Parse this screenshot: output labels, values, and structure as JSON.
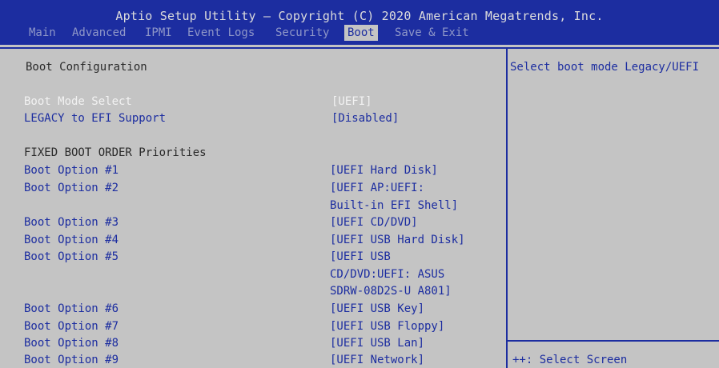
{
  "app": {
    "title": "Aptio Setup Utility – Copyright (C) 2020 American Megatrends, Inc."
  },
  "tabs": [
    "Main",
    "Advanced",
    "IPMI",
    "Event Logs",
    "Security",
    "Boot",
    "Save & Exit"
  ],
  "active_tab": "Boot",
  "left": {
    "section_title": "Boot Configuration",
    "boot_mode": {
      "label": "Boot Mode Select",
      "value": "[UEFI]"
    },
    "legacy": {
      "label": "LEGACY to EFI Support",
      "value": "[Disabled]"
    },
    "priorities_title": "FIXED BOOT ORDER Priorities",
    "boot_options": [
      {
        "label": "Boot Option #1",
        "value_lines": [
          "[UEFI Hard Disk]"
        ]
      },
      {
        "label": "Boot Option #2",
        "value_lines": [
          "[UEFI AP:UEFI:",
          "Built-in EFI Shell]"
        ]
      },
      {
        "label": "Boot Option #3",
        "value_lines": [
          "[UEFI CD/DVD]"
        ]
      },
      {
        "label": "Boot Option #4",
        "value_lines": [
          "[UEFI USB Hard Disk]"
        ]
      },
      {
        "label": "Boot Option #5",
        "value_lines": [
          "[UEFI USB",
          "CD/DVD:UEFI: ASUS",
          "SDRW-08D2S-U A801]"
        ]
      },
      {
        "label": "Boot Option #6",
        "value_lines": [
          "[UEFI USB Key]"
        ]
      },
      {
        "label": "Boot Option #7",
        "value_lines": [
          "[UEFI USB Floppy]"
        ]
      },
      {
        "label": "Boot Option #8",
        "value_lines": [
          "[UEFI USB Lan]"
        ]
      },
      {
        "label": "Boot Option #9",
        "value_lines": [
          "[UEFI Network]"
        ]
      }
    ]
  },
  "help": {
    "description": "Select boot mode Legacy/UEFI",
    "key_hint": "++: Select Screen"
  }
}
